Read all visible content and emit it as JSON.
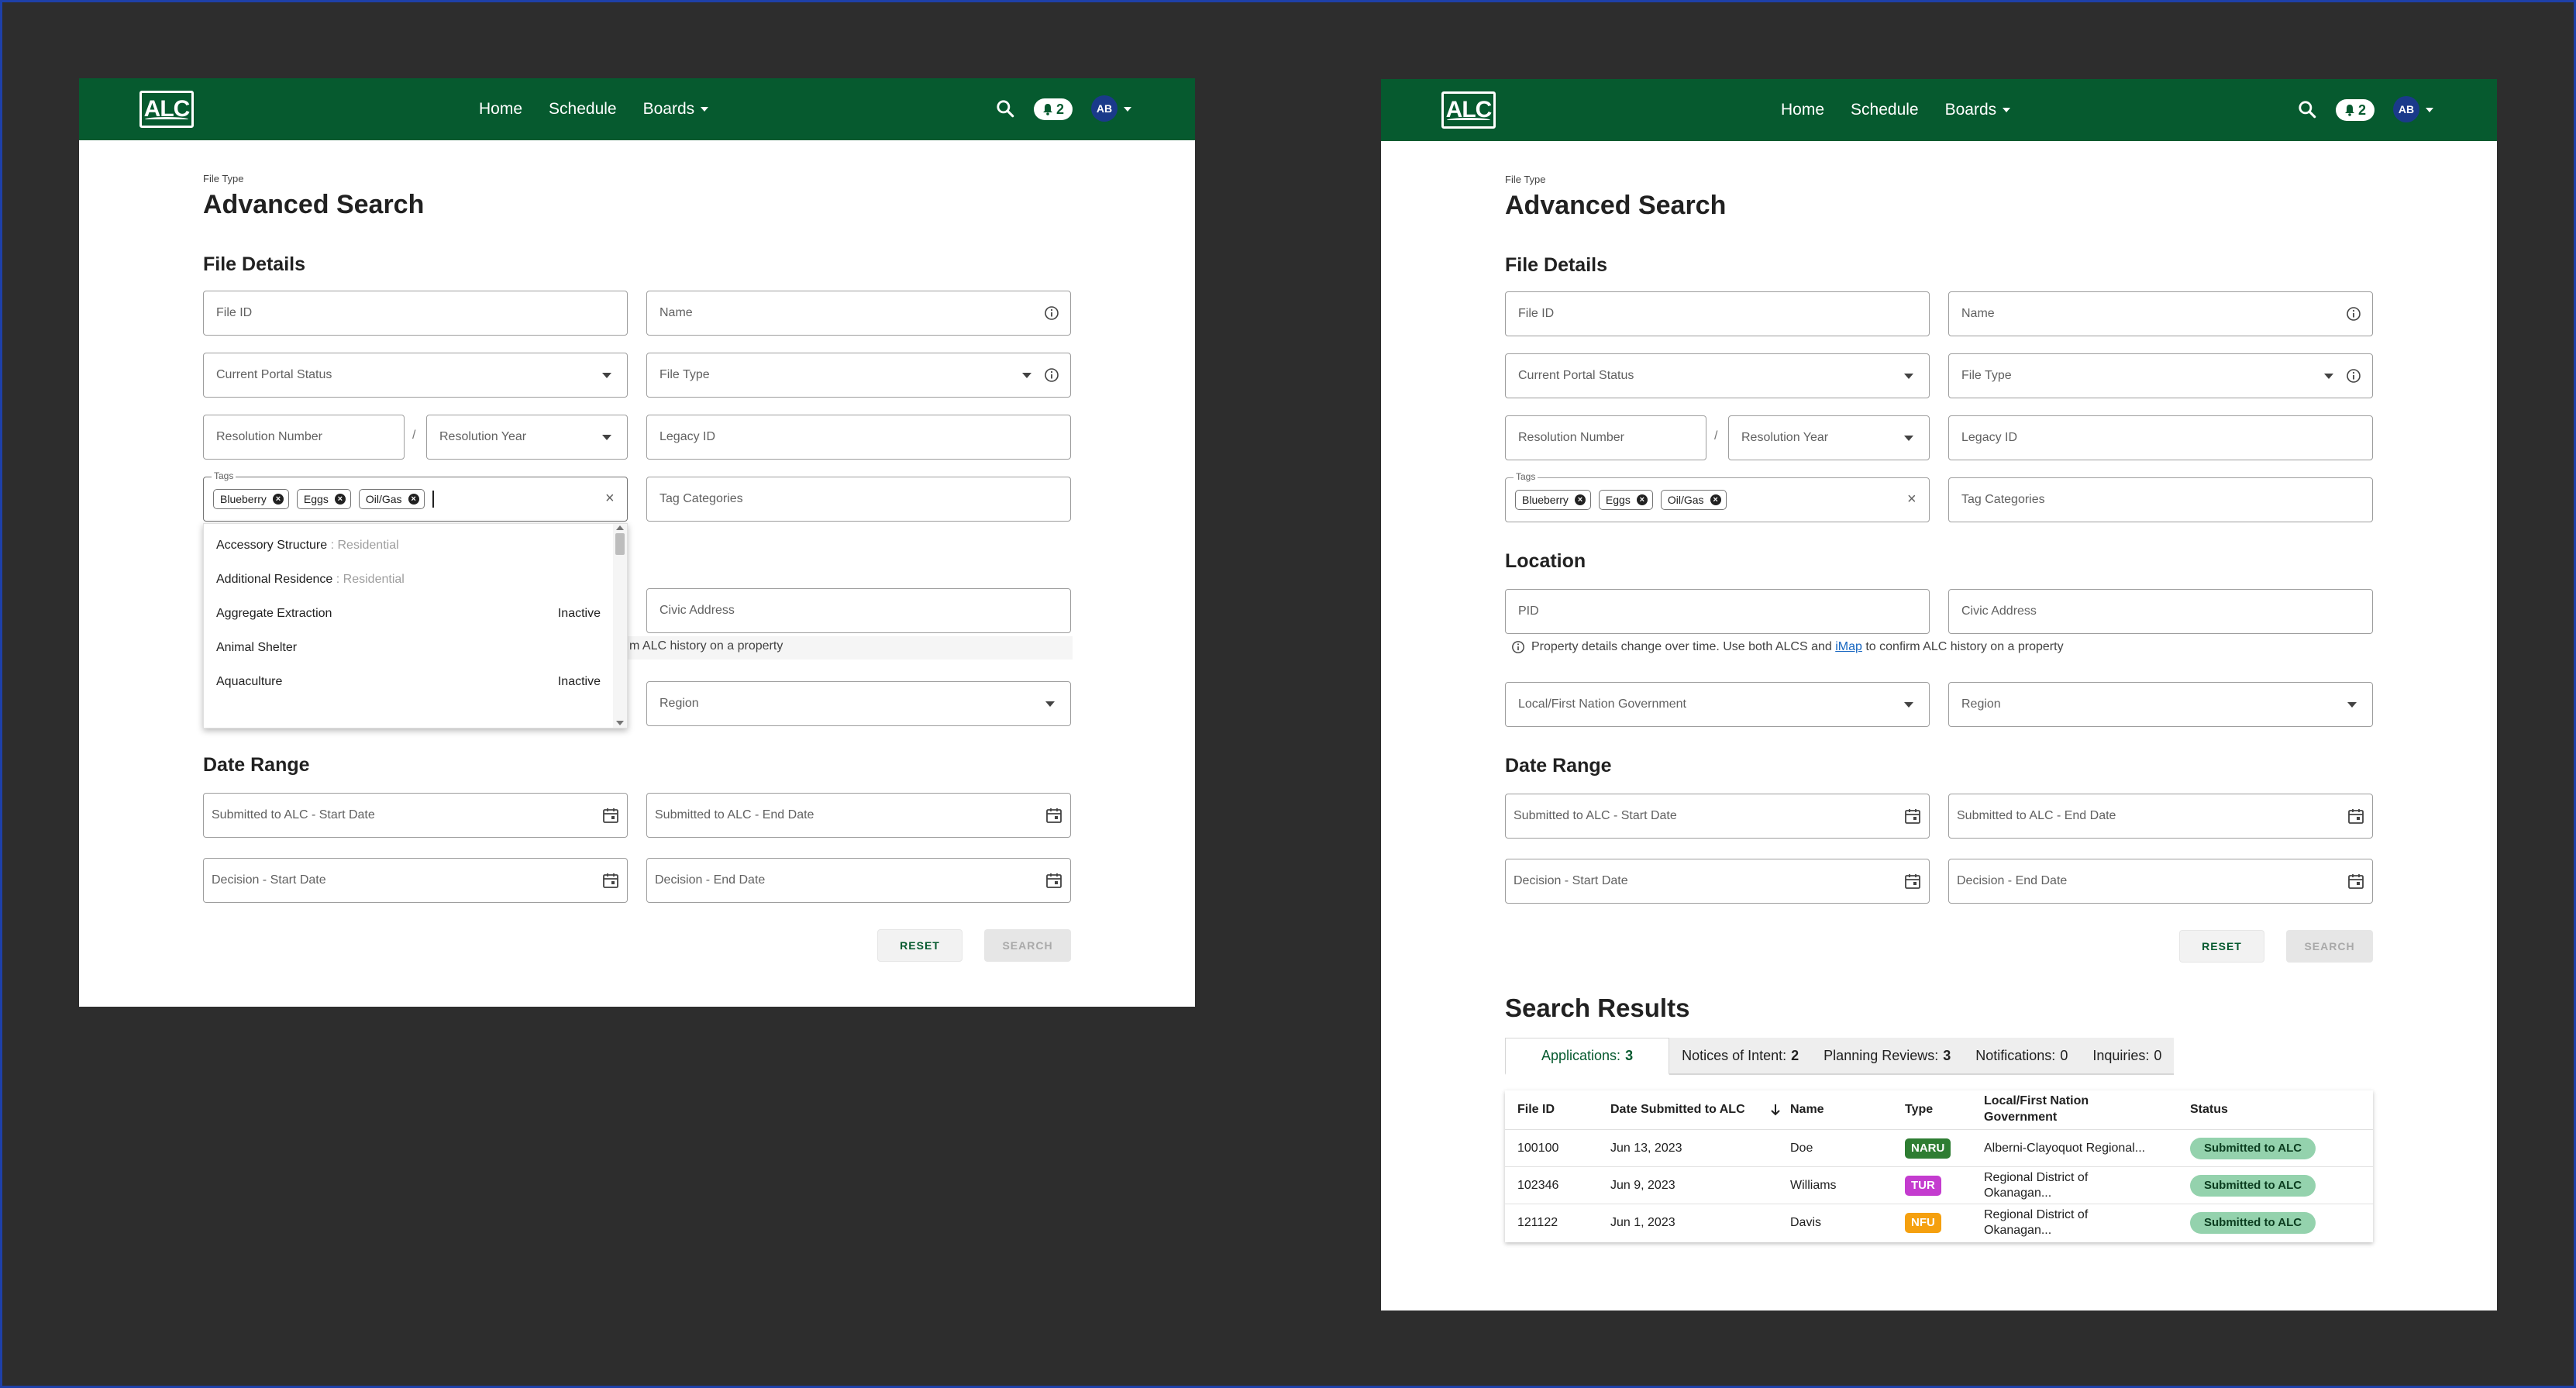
{
  "header": {
    "logo": "ALC",
    "nav": [
      {
        "label": "Home"
      },
      {
        "label": "Schedule"
      },
      {
        "label": "Boards"
      }
    ],
    "notification_count": "2",
    "avatar_initials": "AB"
  },
  "page": {
    "breadcrumb": "File Type",
    "title": "Advanced Search"
  },
  "file_details": {
    "title": "File Details",
    "file_id": "File ID",
    "name": "Name",
    "portal_status": "Current Portal Status",
    "file_type": "File Type",
    "resolution_number": "Resolution Number",
    "slash": "/",
    "resolution_year": "Resolution Year",
    "legacy_id": "Legacy ID",
    "tags_label": "Tags",
    "tags": [
      "Blueberry",
      "Eggs",
      "Oil/Gas"
    ],
    "tag_categories": "Tag Categories",
    "clear": "×"
  },
  "tag_dropdown": {
    "options": [
      {
        "label": "Accessory Structure",
        "sub": " : Residential",
        "status": ""
      },
      {
        "label": "Additional Residence",
        "sub": " : Residential",
        "status": ""
      },
      {
        "label": "Aggregate Extraction",
        "sub": "",
        "status": "Inactive"
      },
      {
        "label": "Animal Shelter",
        "sub": "",
        "status": ""
      },
      {
        "label": "Aquaculture",
        "sub": "",
        "status": "Inactive"
      }
    ]
  },
  "location": {
    "title": "Location",
    "pid": "PID",
    "civic_address": "Civic Address",
    "hint_before": "Property details change over time. Use both ALCS and ",
    "hint_link": "iMap",
    "hint_after": " to confirm ALC history on a property",
    "hint_partial": "m ALC history on a property",
    "government": "Local/First Nation Government",
    "region": "Region"
  },
  "date_range": {
    "title": "Date Range",
    "submitted_start": "Submitted to ALC - Start Date",
    "submitted_end": "Submitted to ALC - End Date",
    "decision_start": "Decision - Start Date",
    "decision_end": "Decision - End Date"
  },
  "buttons": {
    "reset": "RESET",
    "search": "SEARCH"
  },
  "results": {
    "title": "Search Results",
    "tabs": [
      {
        "label": "Applications:",
        "count": "3"
      },
      {
        "label": "Notices of Intent:",
        "count": "2"
      },
      {
        "label": "Planning Reviews:",
        "count": "3"
      },
      {
        "label": "Notifications:",
        "count": "0"
      },
      {
        "label": "Inquiries:",
        "count": "0"
      }
    ],
    "columns": [
      "File ID",
      "Date Submitted to ALC",
      "Name",
      "Type",
      "Local/First Nation Government",
      "Status"
    ],
    "rows": [
      {
        "file_id": "100100",
        "date": "Jun 13, 2023",
        "name": "Doe",
        "type": "NARU",
        "type_color": "#2e7d32",
        "government": "Alberni-Clayoquot Regional...",
        "status": "Submitted to ALC"
      },
      {
        "file_id": "102346",
        "date": "Jun 9, 2023",
        "name": "Williams",
        "type": "TUR",
        "type_color": "#c43ccf",
        "government": "Regional District of Okanagan...",
        "status": "Submitted to ALC"
      },
      {
        "file_id": "121122",
        "date": "Jun 1, 2023",
        "name": "Davis",
        "type": "NFU",
        "type_color": "#f5a00f",
        "government": "Regional District of Okanagan...",
        "status": "Submitted to ALC"
      }
    ]
  },
  "colors": {
    "brand_green": "#065a2f",
    "background": "#2d2d2d",
    "status_badge": "#94d2ad"
  }
}
